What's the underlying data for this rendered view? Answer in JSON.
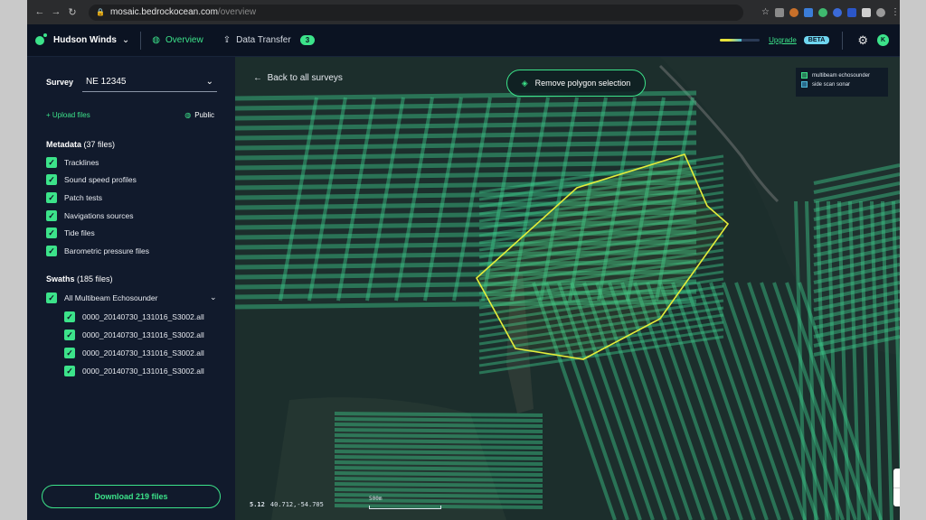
{
  "browser": {
    "url_host": "mosaic.bedrockocean.com",
    "url_path": "/overview"
  },
  "topbar": {
    "brand": "Hudson Winds",
    "tabs": [
      {
        "label": "Overview",
        "icon": "globe-icon",
        "active": true
      },
      {
        "label": "Data Transfer",
        "icon": "transfer-icon",
        "active": false
      }
    ],
    "transfer_count": "3",
    "usage_fraction": 0.55,
    "upgrade_label": "Upgrade",
    "beta_label": "BETA",
    "avatar_initial": "K",
    "accent": "#3ce38a"
  },
  "sidebar": {
    "survey_label": "Survey",
    "survey_value": "NE 12345",
    "upload_label": "+ Upload files",
    "public_label": "Public",
    "metadata": {
      "title": "Metadata",
      "count": "(37 files)",
      "items": [
        "Tracklines",
        "Sound speed profiles",
        "Patch tests",
        "Navigations sources",
        "Tide files",
        "Barometric pressure files"
      ]
    },
    "swaths": {
      "title": "Swaths",
      "count": "(185 files)",
      "group": "All Multibeam Echosounder",
      "files": [
        "0000_20140730_131016_S3002.all",
        "0000_20140730_131016_S3002.all",
        "0000_20140730_131016_S3002.all",
        "0000_20140730_131016_S3002.all"
      ]
    },
    "download_label": "Download 219 files"
  },
  "map": {
    "back_label": "Back to all surveys",
    "remove_polygon_label": "Remove polygon selection",
    "legend": [
      "multibeam echosounder",
      "side scan sonar"
    ],
    "zoom_level": "5.12",
    "coordinates": "40.712,-54.705",
    "scale_label": "500m",
    "zoom_in": "+",
    "zoom_out": "−",
    "colors": {
      "track": "#3cc88a",
      "polygon": "#e4ec3a",
      "water": "#1a2b2a"
    }
  }
}
